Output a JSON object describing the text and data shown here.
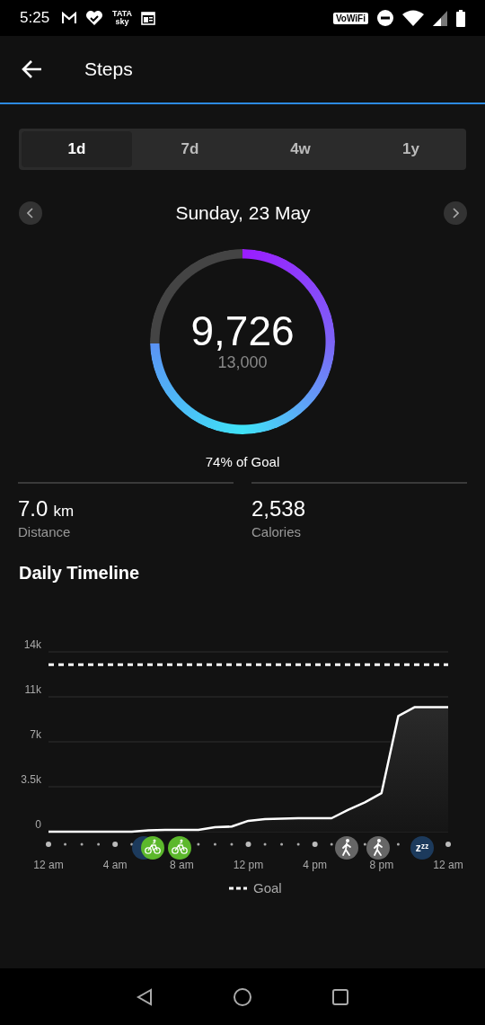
{
  "status_bar": {
    "time": "5:25",
    "tv_badge": [
      "TATA",
      "sky"
    ],
    "wifi_calling": "VoWiFi"
  },
  "header": {
    "title": "Steps"
  },
  "tabs": [
    {
      "label": "1d",
      "selected": true
    },
    {
      "label": "7d",
      "selected": false
    },
    {
      "label": "4w",
      "selected": false
    },
    {
      "label": "1y",
      "selected": false
    }
  ],
  "date": "Sunday, 23 May",
  "goal_ring": {
    "steps": "9,726",
    "goal": "13,000",
    "caption": "74% of Goal"
  },
  "stats": [
    {
      "value": "7.0",
      "unit": "km",
      "label": "Distance"
    },
    {
      "value": "2,538",
      "label": "Calories"
    }
  ],
  "timeline": {
    "title": "Daily Timeline",
    "markers": [
      {
        "kind": "cycling"
      },
      {
        "kind": "cycling"
      },
      {
        "kind": "walking"
      },
      {
        "kind": "walking"
      },
      {
        "kind": "sleep",
        "label": "zᶻᶻ"
      }
    ],
    "chart_data": {
      "type": "area",
      "grid": true,
      "categories": [
        "12 am",
        null,
        null,
        null,
        "4 am",
        null,
        null,
        null,
        "8 am",
        null,
        null,
        null,
        "12 pm",
        null,
        null,
        null,
        "4 pm",
        null,
        null,
        null,
        "8 pm",
        null,
        null,
        null,
        "12 am"
      ],
      "series": [
        {
          "color": "#ffffff",
          "values": [
            0,
            0,
            0,
            0,
            0,
            0,
            100,
            150,
            150,
            150,
            350,
            400,
            850,
            990,
            1020,
            1050,
            1050,
            1050,
            1700,
            2280,
            3000,
            9000,
            9700,
            9700,
            9700
          ]
        },
        {
          "name": "Goal",
          "type": "line",
          "line_style": "dashed",
          "color": "#ffffff",
          "values": [
            13000,
            13000,
            13000,
            13000,
            13000,
            13000,
            13000,
            13000,
            13000,
            13000,
            13000,
            13000,
            13000,
            13000,
            13000,
            13000,
            13000,
            13000,
            13000,
            13000,
            13000,
            13000,
            13000,
            13000,
            13000
          ]
        }
      ],
      "ylim": [
        0,
        14000
      ],
      "yticks": [
        {
          "value": 0,
          "label": "0"
        },
        {
          "value": 3500,
          "label": "3.5k"
        },
        {
          "value": 7000,
          "label": "7k"
        },
        {
          "value": 10500,
          "label": "11k"
        },
        {
          "value": 14000,
          "label": "14k"
        }
      ]
    }
  }
}
